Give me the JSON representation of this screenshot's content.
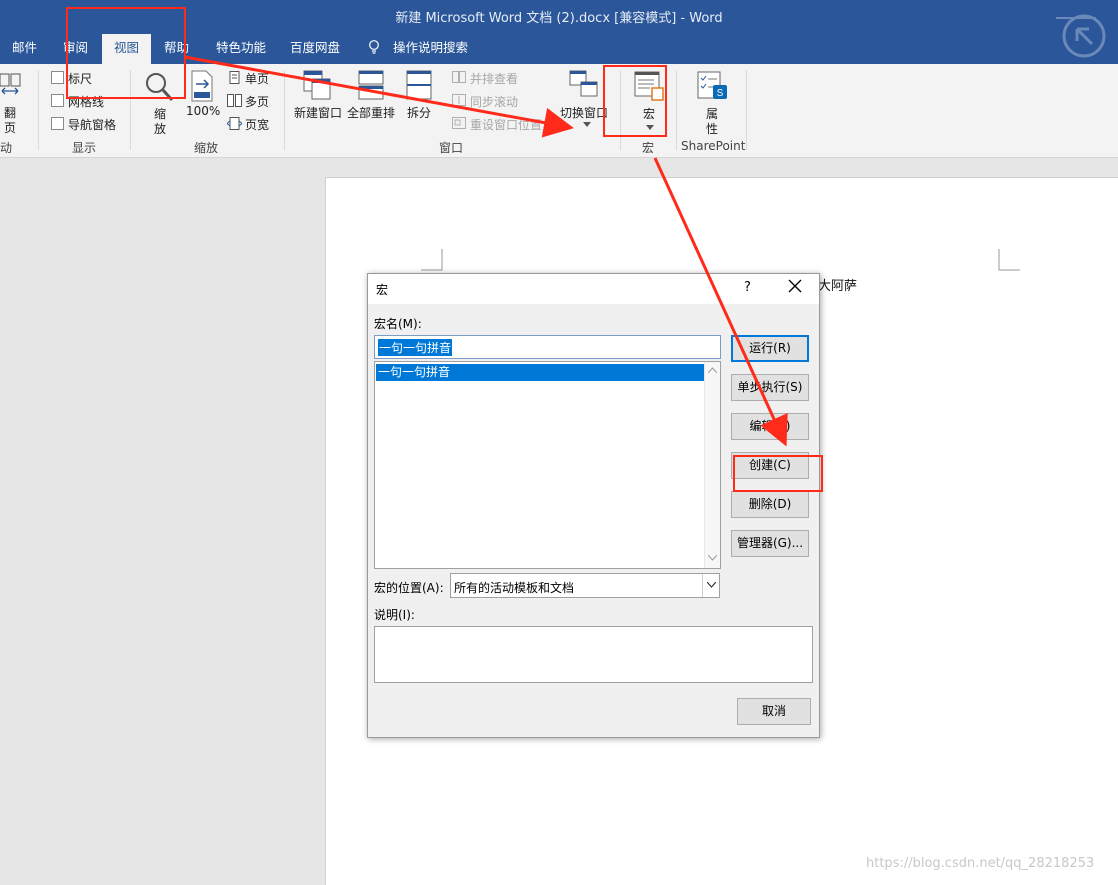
{
  "window": {
    "title": "新建 Microsoft Word 文档 (2).docx [兼容模式]  -  Word"
  },
  "tabs": [
    {
      "label": "邮件"
    },
    {
      "label": "审阅"
    },
    {
      "label": "视图",
      "active": true
    },
    {
      "label": "帮助"
    },
    {
      "label": "特色功能"
    },
    {
      "label": "百度网盘"
    },
    {
      "label": "操作说明搜索"
    }
  ],
  "ribbon": {
    "page_move": {
      "label_1": "翻",
      "label_2": "页",
      "group": "动"
    },
    "show": {
      "ruler": "标尺",
      "gridlines": "网格线",
      "nav_pane": "导航窗格",
      "group": "显示"
    },
    "zoom": {
      "zoom_1": "缩",
      "zoom_2": "放",
      "percent": "100%",
      "one_page": "单页",
      "multi_page": "多页",
      "page_width": "页宽",
      "group": "缩放"
    },
    "window": {
      "new_window": "新建窗口",
      "arrange_all": "全部重排",
      "split": "拆分",
      "side_by_side": "并排查看",
      "sync_scroll": "同步滚动",
      "reset_position": "重设窗口位置",
      "switch_window": "切换窗口",
      "group": "窗口"
    },
    "macros": {
      "label": "宏",
      "group": "宏"
    },
    "sharepoint": {
      "label_1": "属",
      "label_2": "性",
      "group": "SharePoint"
    }
  },
  "document": {
    "text": "大阿萨"
  },
  "dialog": {
    "title": "宏",
    "help": "?",
    "macro_name_label": "宏名(M):",
    "macro_name_value": "一句一句拼音",
    "macro_list": [
      "一句一句拼音"
    ],
    "buttons": {
      "run": "运行(R)",
      "step": "单步执行(S)",
      "edit": "编辑(E)",
      "create": "创建(C)",
      "delete": "删除(D)",
      "organizer": "管理器(G)...",
      "cancel": "取消"
    },
    "location_label": "宏的位置(A):",
    "location_value": "所有的活动模板和文档",
    "description_label": "说明(I):"
  },
  "watermark": "https://blog.csdn.net/qq_28218253",
  "colors": {
    "title_bar": "#2b579a",
    "selection": "#0078d7",
    "annotation": "#ff2a1a"
  }
}
